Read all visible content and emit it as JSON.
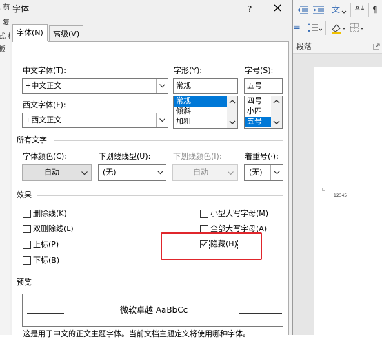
{
  "bg_left": {
    "lines": [
      ", 剪",
      "i 复",
      "式 格",
      "板"
    ]
  },
  "dialog": {
    "title": "字体",
    "help": "?",
    "close": "×",
    "tabs": [
      "字体(N)",
      "高级(V)"
    ],
    "chinese_font": {
      "label": "中文字体(T):",
      "value": "+中文正文"
    },
    "style": {
      "label": "字形(Y):",
      "value": "常规",
      "options": [
        "常规",
        "倾斜",
        "加粗"
      ]
    },
    "size": {
      "label": "字号(S):",
      "value": "五号",
      "options": [
        "四号",
        "小四",
        "五号"
      ]
    },
    "western_font": {
      "label": "西文字体(F):",
      "value": "+西文正文"
    },
    "all_text": {
      "section": "所有文字",
      "color_label": "字体颜色(C):",
      "color_value": "自动",
      "underline_label": "下划线线型(U):",
      "underline_value": "(无)",
      "underline_color_label": "下划线颜色(I):",
      "underline_color_value": "自动",
      "emphasis_label": "着重号(·):",
      "emphasis_value": "(无)"
    },
    "effects": {
      "section": "效果",
      "strike": "删除线(K)",
      "double_strike": "双删除线(L)",
      "superscript": "上标(P)",
      "subscript": "下标(B)",
      "small_caps": "小型大写字母(M)",
      "all_caps": "全部大写字母(A)",
      "hidden": "隐藏(H)",
      "hidden_checked": true
    },
    "preview": {
      "section": "预览",
      "sample": "微软卓越 AaBbCc",
      "note": "这是用于中文的正文主题字体。当前文档主题定义将使用哪种字体。"
    }
  },
  "ribbon": {
    "paragraph_label": "段落",
    "sort_icon": "A↓",
    "align_icon": "≡"
  },
  "document": {
    "text": "12345"
  },
  "annotation": {
    "color": "#e0262c"
  }
}
